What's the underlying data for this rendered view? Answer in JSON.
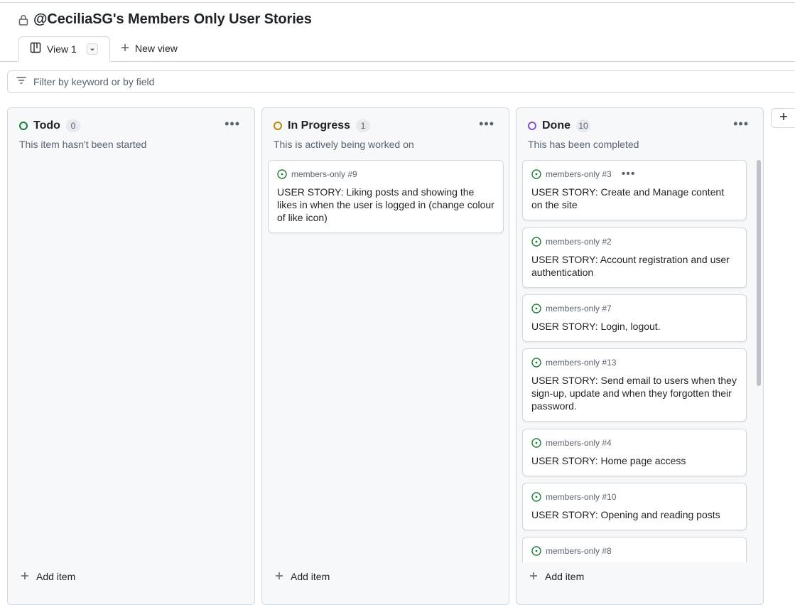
{
  "page": {
    "title": "@CeciliaSG's Members Only User Stories"
  },
  "views": {
    "active_tab": "View 1",
    "new_view_label": "New view"
  },
  "filter": {
    "placeholder": "Filter by keyword or by field"
  },
  "colors": {
    "todo": "#1a7f37",
    "in_progress": "#bf8700",
    "done": "#8250df",
    "issue_open": "#1a7f37"
  },
  "columns": [
    {
      "name": "Todo",
      "count": "0",
      "description": "This item hasn't been started",
      "add_label": "Add item",
      "cards": []
    },
    {
      "name": "In Progress",
      "count": "1",
      "description": "This is actively being worked on",
      "add_label": "Add item",
      "cards": [
        {
          "ref": "members-only #9",
          "title": "USER STORY: Liking posts and showing the likes in when the user is logged in (change colour of like icon)"
        }
      ]
    },
    {
      "name": "Done",
      "count": "10",
      "description": "This has been completed",
      "add_label": "Add item",
      "cards": [
        {
          "ref": "members-only #3",
          "title": "USER STORY: Create and Manage content on the site"
        },
        {
          "ref": "members-only #2",
          "title": "USER STORY: Account registration and user authentication"
        },
        {
          "ref": "members-only #7",
          "title": "USER STORY: Login, logout."
        },
        {
          "ref": "members-only #13",
          "title": "USER STORY: Send email to users when they sign-up, update and when they forgotten their password."
        },
        {
          "ref": "members-only #4",
          "title": "USER STORY: Home page access"
        },
        {
          "ref": "members-only #10",
          "title": "USER STORY: Opening and reading posts"
        },
        {
          "ref": "members-only #8",
          "title": ""
        }
      ]
    }
  ]
}
